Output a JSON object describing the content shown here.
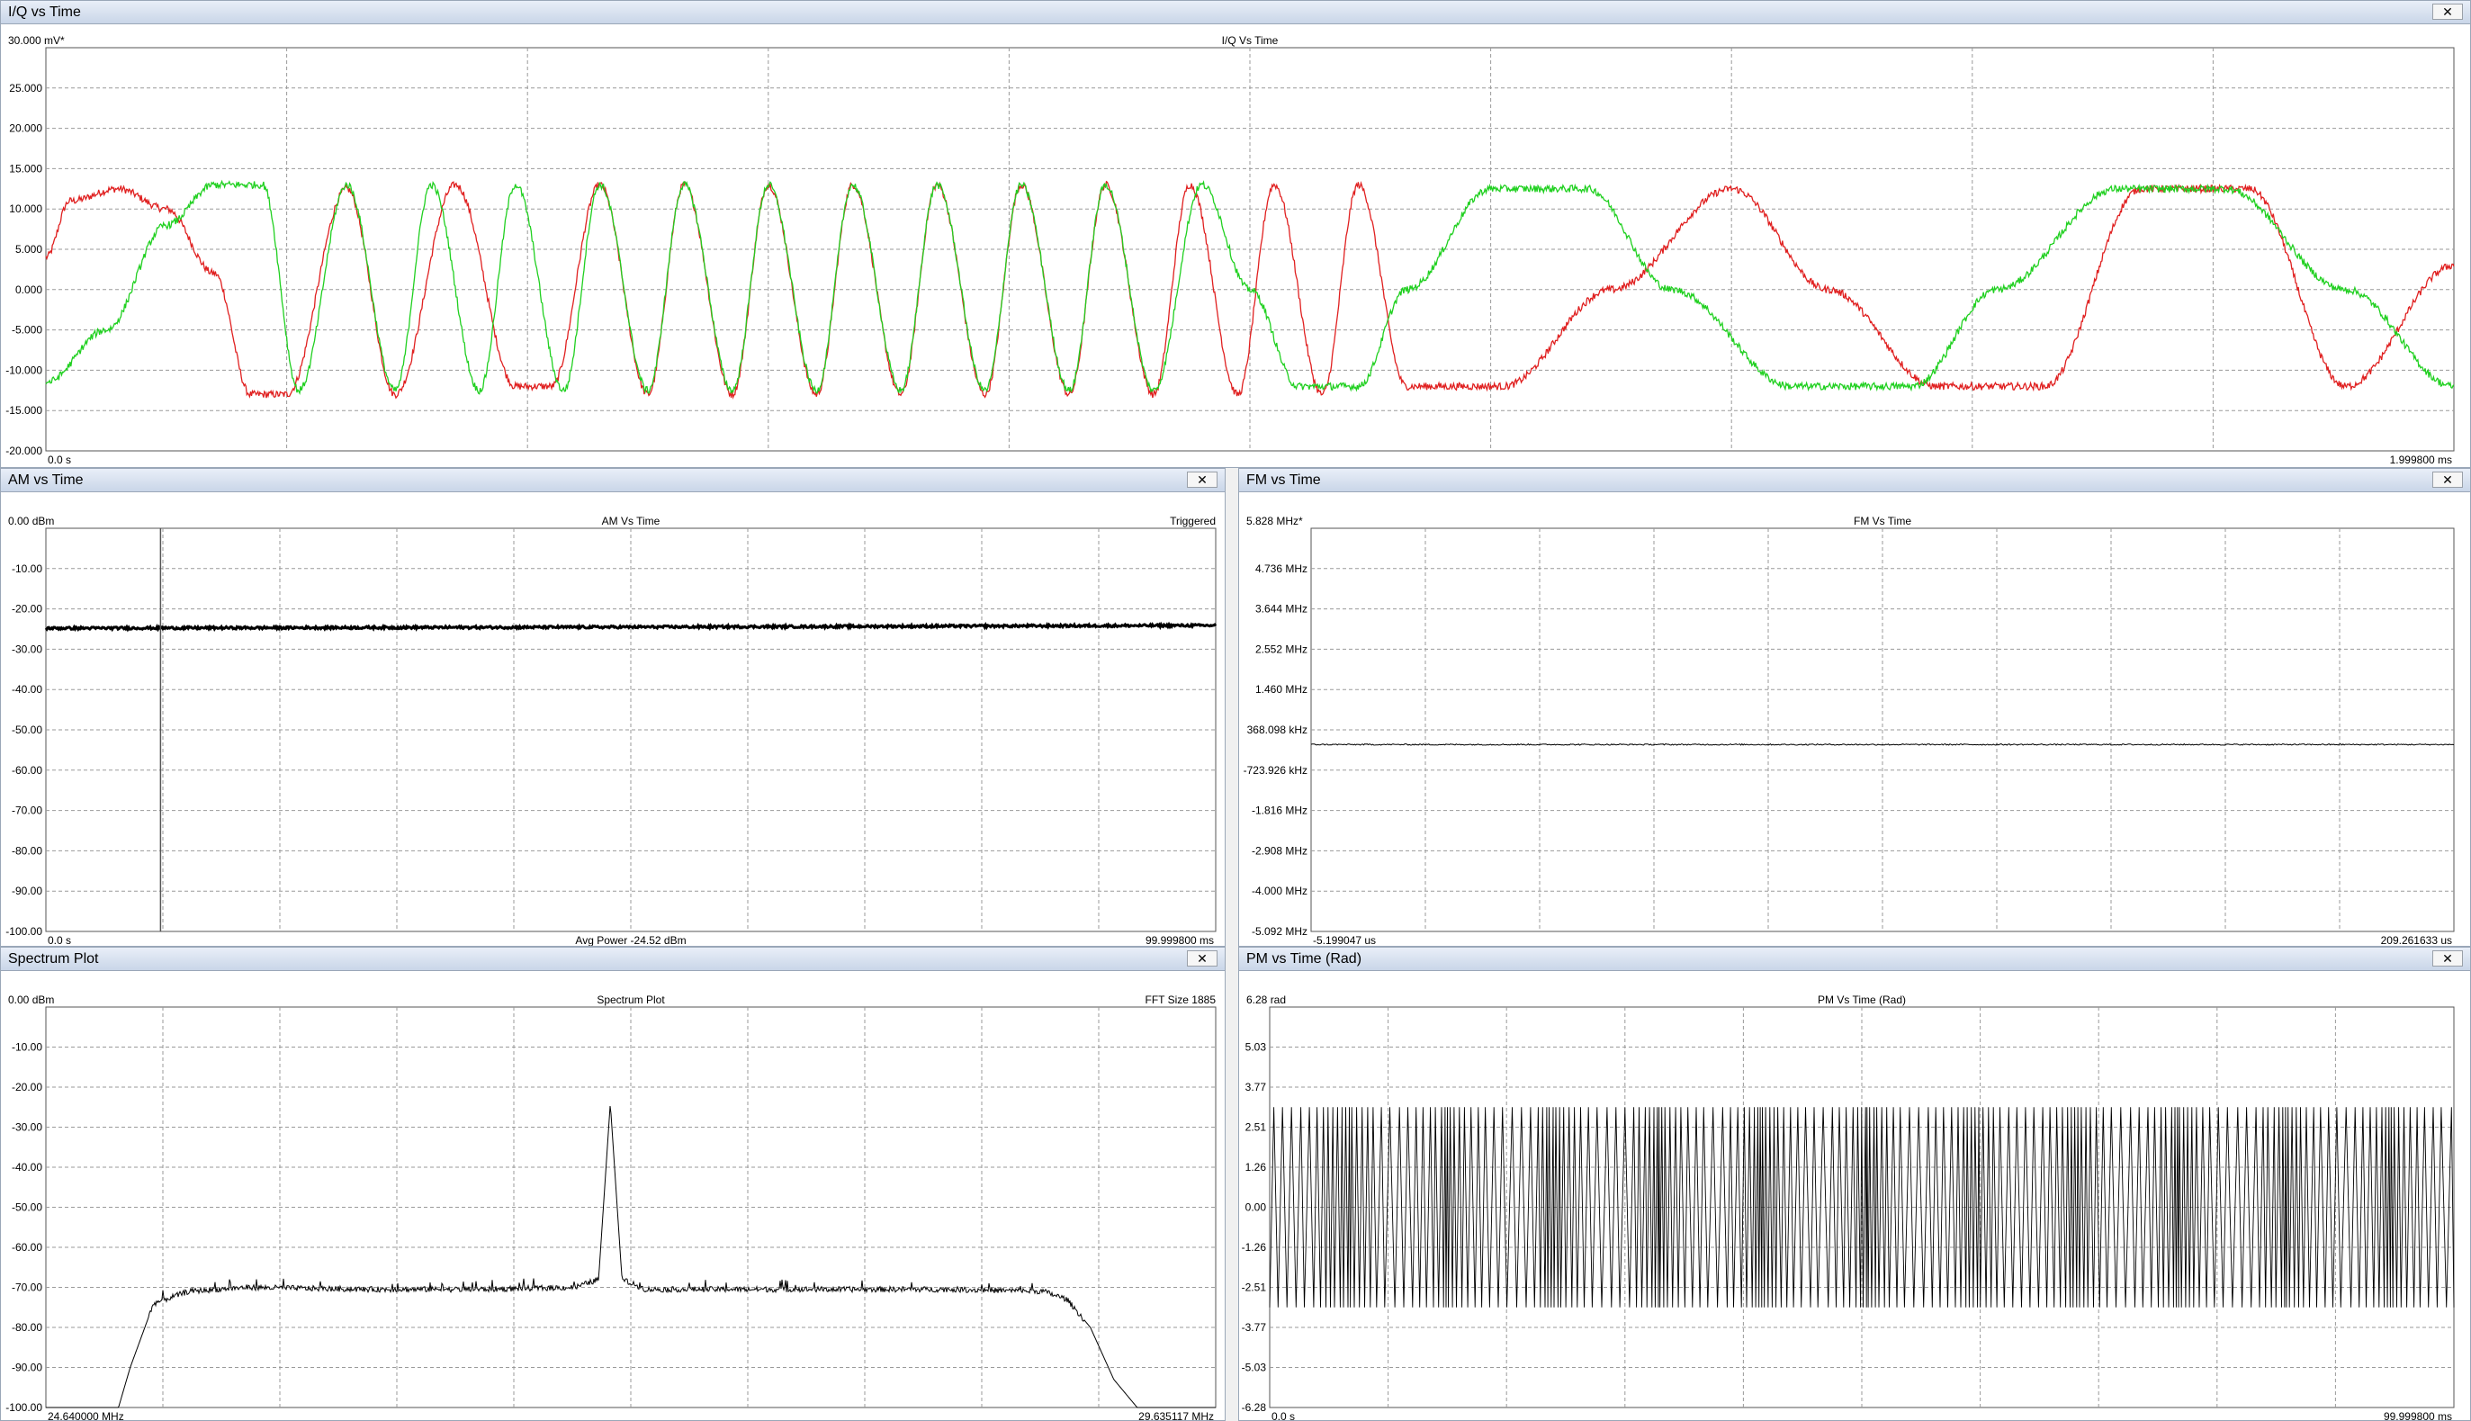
{
  "panels": {
    "iq": {
      "title": "I/Q vs Time",
      "close": "✕",
      "top_left": "30.000 mV*",
      "center_title": "I/Q Vs Time",
      "bottom_left": "0.0 s",
      "bottom_right": "1.999800 ms",
      "y_ticks": [
        "25.000",
        "20.000",
        "15.000",
        "10.000",
        "5.000",
        "0.000",
        "-5.000",
        "-10.000",
        "-15.000",
        "-20.000"
      ]
    },
    "am": {
      "title": "AM vs Time",
      "close": "✕",
      "top_left": "0.00 dBm",
      "center_title": "AM Vs Time",
      "top_right": "Triggered",
      "bottom_left": "0.0 s",
      "bottom_center": "Avg Power -24.52 dBm",
      "bottom_right": "99.999800 ms",
      "y_ticks": [
        "-10.00",
        "-20.00",
        "-30.00",
        "-40.00",
        "-50.00",
        "-60.00",
        "-70.00",
        "-80.00",
        "-90.00",
        "-100.00"
      ]
    },
    "fm": {
      "title": "FM vs Time",
      "close": "✕",
      "top_left": "5.828 MHz*",
      "center_title": "FM Vs Time",
      "bottom_left": "-5.199047 us",
      "bottom_right": "209.261633 us",
      "y_ticks": [
        "4.736 MHz",
        "3.644 MHz",
        "2.552 MHz",
        "1.460 MHz",
        "368.098 kHz",
        "-723.926 kHz",
        "-1.816 MHz",
        "-2.908 MHz",
        "-4.000 MHz",
        "-5.092 MHz"
      ]
    },
    "spectrum": {
      "title": "Spectrum Plot",
      "close": "✕",
      "top_left": "0.00 dBm",
      "center_title": "Spectrum Plot",
      "top_right": "FFT Size 1885",
      "bottom_left": "24.640000 MHz",
      "bottom_right": "29.635117 MHz",
      "y_ticks": [
        "-10.00",
        "-20.00",
        "-30.00",
        "-40.00",
        "-50.00",
        "-60.00",
        "-70.00",
        "-80.00",
        "-90.00",
        "-100.00"
      ]
    },
    "pm": {
      "title": "PM vs Time (Rad)",
      "close": "✕",
      "top_left": "6.28 rad",
      "center_title": "PM Vs Time (Rad)",
      "bottom_left": "0.0 s",
      "bottom_right": "99.999800 ms",
      "y_ticks": [
        "5.03",
        "3.77",
        "2.51",
        "1.26",
        "0.00",
        "-1.26",
        "-2.51",
        "-3.77",
        "-5.03",
        "-6.28"
      ]
    }
  },
  "colors": {
    "i_trace": "#e02020",
    "q_trace": "#20d020",
    "trace": "#000000",
    "grid": "#9a9a9a"
  },
  "chart_data": [
    {
      "type": "line",
      "title": "I/Q Vs Time",
      "x_range": [
        0,
        1.9998
      ],
      "x_unit": "ms",
      "ylim": [
        -20,
        30
      ],
      "y_unit": "mV",
      "series": [
        {
          "name": "",
          "color": "#e02020",
          "x": [
            0,
            0.02,
            0.06,
            0.1,
            0.14,
            0.17,
            0.2,
            0.25,
            0.29,
            0.34,
            0.39,
            0.42,
            0.46,
            0.5,
            0.53,
            0.57,
            0.6,
            0.64,
            0.67,
            0.71,
            0.74,
            0.78,
            0.81,
            0.85,
            0.88,
            0.92,
            0.95,
            0.99,
            1.02,
            1.06,
            1.09,
            1.13,
            1.21,
            1.3,
            1.4,
            1.48,
            1.57,
            1.66,
            1.74,
            1.83,
            1.91,
            2.0
          ],
          "y": [
            4,
            11,
            12.5,
            10,
            2,
            -13,
            -13,
            12.5,
            -13,
            13,
            -12,
            -12,
            13,
            -13,
            13,
            -13,
            13,
            -13,
            13,
            -13,
            13,
            -13,
            13,
            -13,
            13,
            -13,
            13,
            -13,
            13,
            -13,
            13,
            -12,
            -12,
            0,
            12.5,
            0,
            -12,
            -12,
            12.5,
            12.5,
            -12,
            3
          ]
        },
        {
          "name": "",
          "color": "#20d020",
          "x": [
            0,
            0.05,
            0.1,
            0.14,
            0.18,
            0.21,
            0.25,
            0.29,
            0.32,
            0.36,
            0.39,
            0.43,
            0.46,
            0.5,
            0.53,
            0.57,
            0.6,
            0.64,
            0.67,
            0.71,
            0.74,
            0.78,
            0.81,
            0.85,
            0.88,
            0.92,
            0.96,
            1.0,
            1.04,
            1.09,
            1.13,
            1.2,
            1.28,
            1.35,
            1.45,
            1.55,
            1.62,
            1.72,
            1.81,
            1.91,
            2.0
          ],
          "y": [
            -11.5,
            -5,
            8,
            13,
            13,
            -12.5,
            13,
            -12.5,
            13,
            -12.5,
            13,
            -12.5,
            13,
            -12.5,
            13,
            -12.5,
            13,
            -12.5,
            13,
            -12.5,
            13,
            -12.5,
            13,
            -12.5,
            13,
            -12.5,
            13,
            0,
            -12,
            -12,
            0,
            12.5,
            12.5,
            0,
            -12,
            -12,
            0,
            12.5,
            12.5,
            0,
            -12
          ]
        }
      ]
    },
    {
      "type": "line",
      "title": "AM Vs Time",
      "x_range": [
        0,
        99.9998
      ],
      "x_unit": "ms",
      "ylim": [
        -100,
        0
      ],
      "y_unit": "dBm",
      "series": [
        {
          "name": "",
          "x": [
            0,
            50,
            99.9998
          ],
          "values": [
            -24.8,
            -24.5,
            -24.1
          ]
        }
      ],
      "marker_x": 9.8,
      "annotations": [
        "Triggered",
        "Avg Power -24.52 dBm"
      ]
    },
    {
      "type": "line",
      "title": "FM Vs Time",
      "x_range": [
        -5.199047,
        209.261633
      ],
      "x_unit": "us",
      "y_range_labels": [
        "5.828 MHz",
        "-5.092 MHz"
      ],
      "series": [
        {
          "name": "",
          "x": [
            -5.199047,
            209.261633
          ],
          "values": [
            -0.03,
            -0.03
          ],
          "unit": "MHz"
        }
      ]
    },
    {
      "type": "line",
      "title": "Spectrum Plot",
      "x_range": [
        24.64,
        29.635117
      ],
      "x_unit": "MHz",
      "ylim": [
        -100,
        0
      ],
      "y_unit": "dBm",
      "series": [
        {
          "name": "",
          "x": [
            24.64,
            24.95,
            25.0,
            25.1,
            25.25,
            25.5,
            26.0,
            26.5,
            26.9,
            27.0,
            27.05,
            27.1,
            27.2,
            27.5,
            28.0,
            28.5,
            28.9,
            29.0,
            29.1,
            29.2,
            29.3,
            29.635117
          ],
          "values": [
            -100,
            -100,
            -90,
            -74,
            -71,
            -70,
            -70.5,
            -70.5,
            -70,
            -68,
            -24,
            -68,
            -70.5,
            -70.5,
            -70.5,
            -70.5,
            -71,
            -73,
            -80,
            -93,
            -100,
            -100
          ]
        }
      ],
      "annotations": [
        "FFT Size 1885"
      ]
    },
    {
      "type": "line",
      "title": "PM Vs Time (Rad)",
      "x_range": [
        0,
        99.9998
      ],
      "x_unit": "ms",
      "ylim": [
        -6.28,
        6.28
      ],
      "y_unit": "rad",
      "series": [
        {
          "name": "",
          "values_range": [
            -3.14,
            3.14
          ],
          "pattern": "wrapped phase sawtooth"
        }
      ]
    }
  ]
}
